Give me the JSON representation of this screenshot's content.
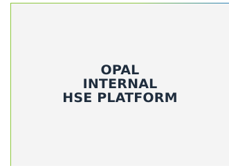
{
  "panel": {
    "title_lines": [
      "OPAL",
      "INTERNAL",
      "HSE PLATFORM"
    ]
  },
  "colors": {
    "panel_background": "#f4f4f4",
    "border_accent_green": "#8cc63e",
    "border_accent_blue": "#2a7fb8",
    "title_text": "#1f2d3d"
  }
}
